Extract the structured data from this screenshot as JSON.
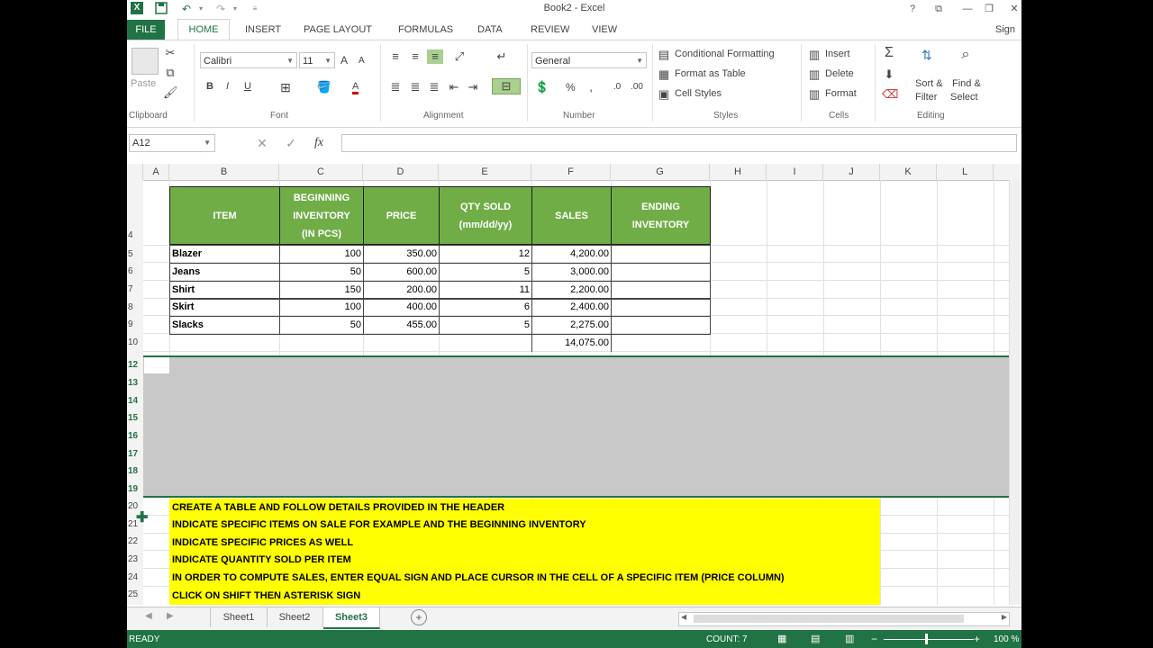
{
  "titlebar": {
    "title": "Book2 - Excel",
    "help": "?",
    "restore": "⧉",
    "minimize": "—",
    "maximize": "❐",
    "close": "✕"
  },
  "tabs": {
    "file": "FILE",
    "home": "HOME",
    "insert": "INSERT",
    "page_layout": "PAGE LAYOUT",
    "formulas": "FORMULAS",
    "data": "DATA",
    "review": "REVIEW",
    "view": "VIEW",
    "sign_in": "Sign"
  },
  "ribbon": {
    "clipboard": {
      "paste": "Paste",
      "label": "Clipboard"
    },
    "font": {
      "name": "Calibri",
      "size": "11",
      "label": "Font",
      "bold": "B",
      "italic": "I",
      "underline": "U",
      "grow": "A",
      "shrink": "A",
      "font_color": "A"
    },
    "alignment": {
      "label": "Alignment"
    },
    "number": {
      "format": "General",
      "label": "Number",
      "percent": "%"
    },
    "styles": {
      "conditional": "Conditional Formatting",
      "format_table": "Format as Table",
      "cell_styles": "Cell Styles",
      "label": "Styles"
    },
    "cells": {
      "insert": "Insert",
      "delete": "Delete",
      "format": "Format",
      "label": "Cells"
    },
    "editing": {
      "sort": "Sort &",
      "filter": "Filter",
      "find": "Find &",
      "select": "Select",
      "label": "Editing"
    }
  },
  "formula_bar": {
    "name_box": "A12",
    "fx": "fx",
    "value": ""
  },
  "columns": [
    "A",
    "B",
    "C",
    "D",
    "E",
    "F",
    "G",
    "H",
    "I",
    "J",
    "K",
    "L"
  ],
  "rows": {
    "r4": "4",
    "r5": "5",
    "r6": "6",
    "r7": "7",
    "r8": "8",
    "r9": "9",
    "r10": "10",
    "r12": "12",
    "r13": "13",
    "r14": "14",
    "r15": "15",
    "r16": "16",
    "r17": "17",
    "r18": "18",
    "r19": "19",
    "r20": "20",
    "r21": "21",
    "r22": "22",
    "r23": "23",
    "r24": "24",
    "r25": "25"
  },
  "table": {
    "headers": {
      "item": "ITEM",
      "beg1": "BEGINNING",
      "beg2": "INVENTORY",
      "beg3": "(IN PCS)",
      "price": "PRICE",
      "qty1": "QTY SOLD",
      "qty2": "(mm/dd/yy)",
      "sales": "SALES",
      "end1": "ENDING",
      "end2": "INVENTORY"
    },
    "rows": [
      {
        "item": "Blazer",
        "beg": "100",
        "price": "350.00",
        "qty": "12",
        "sales": "4,200.00"
      },
      {
        "item": "Jeans",
        "beg": "50",
        "price": "600.00",
        "qty": "5",
        "sales": "3,000.00"
      },
      {
        "item": "Shirt",
        "beg": "150",
        "price": "200.00",
        "qty": "11",
        "sales": "2,200.00"
      },
      {
        "item": "Skirt",
        "beg": "100",
        "price": "400.00",
        "qty": "6",
        "sales": "2,400.00"
      },
      {
        "item": "Slacks",
        "beg": "50",
        "price": "455.00",
        "qty": "5",
        "sales": "2,275.00"
      }
    ],
    "total": "14,075.00"
  },
  "notes": [
    "CREATE A TABLE AND FOLLOW DETAILS PROVIDED IN THE HEADER",
    "INDICATE SPECIFIC ITEMS ON SALE FOR EXAMPLE AND THE BEGINNING INVENTORY",
    "INDICATE SPECIFIC PRICES AS WELL",
    "INDICATE QUANTITY SOLD PER ITEM",
    "IN ORDER TO COMPUTE SALES, ENTER EQUAL SIGN AND PLACE CURSOR IN THE CELL OF A SPECIFIC ITEM (PRICE COLUMN)",
    "CLICK ON SHIFT THEN ASTERISK SIGN"
  ],
  "sheets": {
    "s1": "Sheet1",
    "s2": "Sheet2",
    "s3": "Sheet3",
    "add": "+"
  },
  "status": {
    "ready": "READY",
    "count": "COUNT: 7",
    "zoom": "100 %",
    "minus": "−",
    "plus": "+"
  },
  "colors": {
    "excel_green": "#217346",
    "header_green": "#70ad47",
    "note_yellow": "#ffff00"
  }
}
